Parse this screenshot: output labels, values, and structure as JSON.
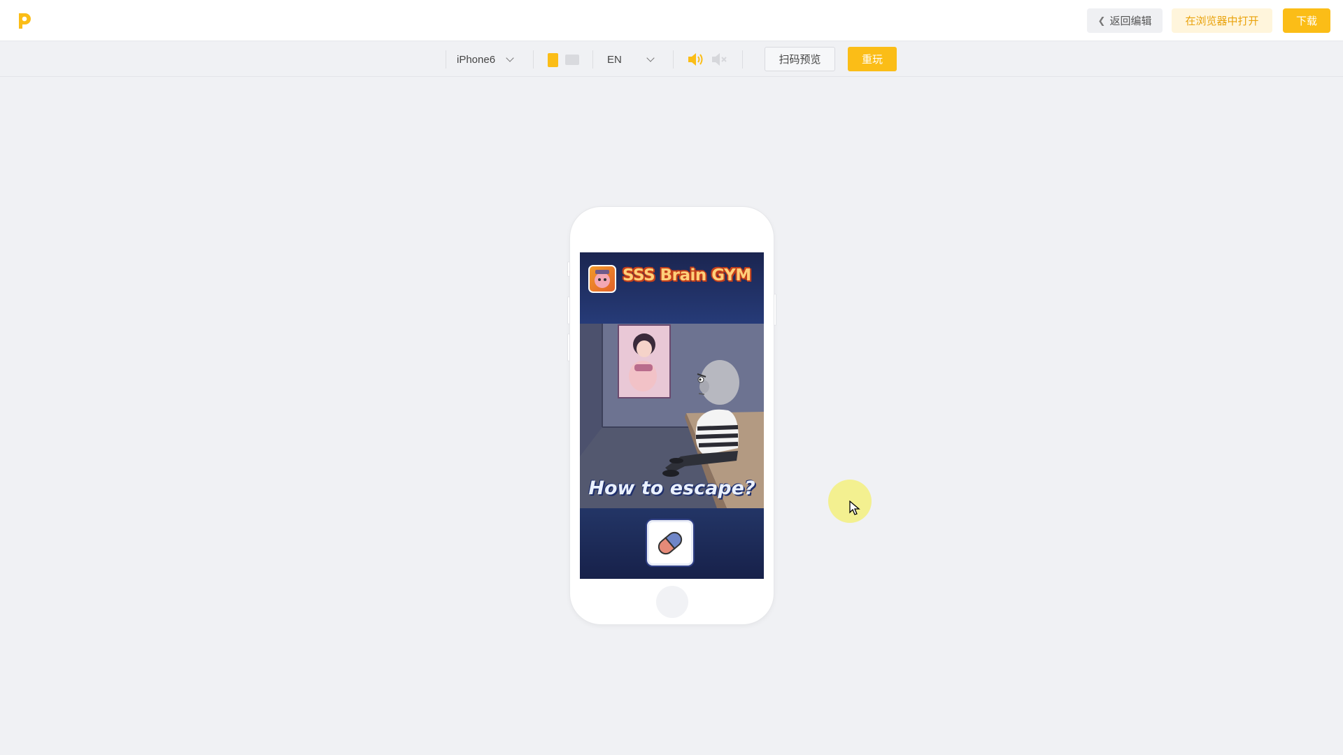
{
  "header": {
    "back_label": "返回编辑",
    "open_browser_label": "在浏览器中打开",
    "download_label": "下载"
  },
  "toolbar": {
    "device": "iPhone6",
    "language": "EN",
    "orientation_selected": "portrait",
    "sound": "on",
    "scan_label": "扫码预览",
    "replay_label": "重玩"
  },
  "game": {
    "title": "SSS Brain GYM",
    "caption": "How to escape?",
    "action_icon": "eraser-icon"
  },
  "colors": {
    "accent": "#fbbd17",
    "accent_light_bg": "#fff5dc",
    "accent_text": "#e9a20b",
    "page_bg": "#f0f1f4"
  }
}
